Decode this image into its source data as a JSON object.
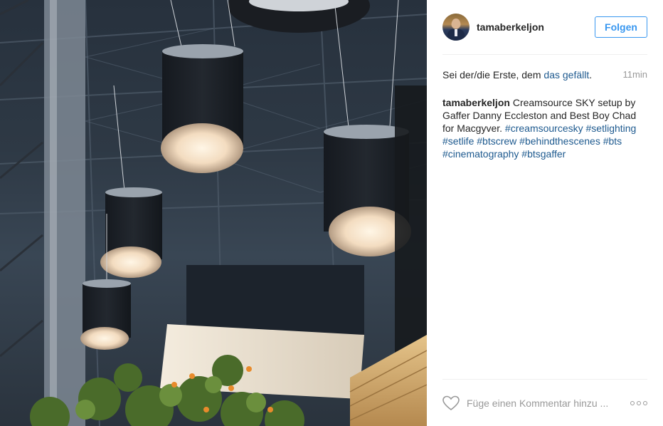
{
  "photo": {
    "icon": "photo-of-creamsource-sky-lights"
  },
  "post": {
    "username": "tamaberkeljon",
    "follow_label": "Folgen",
    "likes_prefix": "Sei der/die Erste, dem ",
    "likes_link": "das gefällt",
    "likes_suffix": ".",
    "timestamp": "11min",
    "caption_user": "tamaberkeljon",
    "caption_text": "Creamsource SKY setup by Gaffer Danny Eccleston and Best Boy Chad for Macgyver.",
    "hashtags": [
      "#creamsourcesky",
      "#setlighting",
      "#setlife",
      "#btscrew",
      "#behindthescenes",
      "#bts",
      "#cinematography",
      "#btsgaffer"
    ],
    "comment_placeholder": "Füge einen Kommentar hinzu ...",
    "icons": {
      "like": "heart-icon",
      "more": "more-options-icon"
    }
  },
  "colors": {
    "accent": "#3897f0",
    "link": "#1e5a8f",
    "muted": "#999999"
  }
}
